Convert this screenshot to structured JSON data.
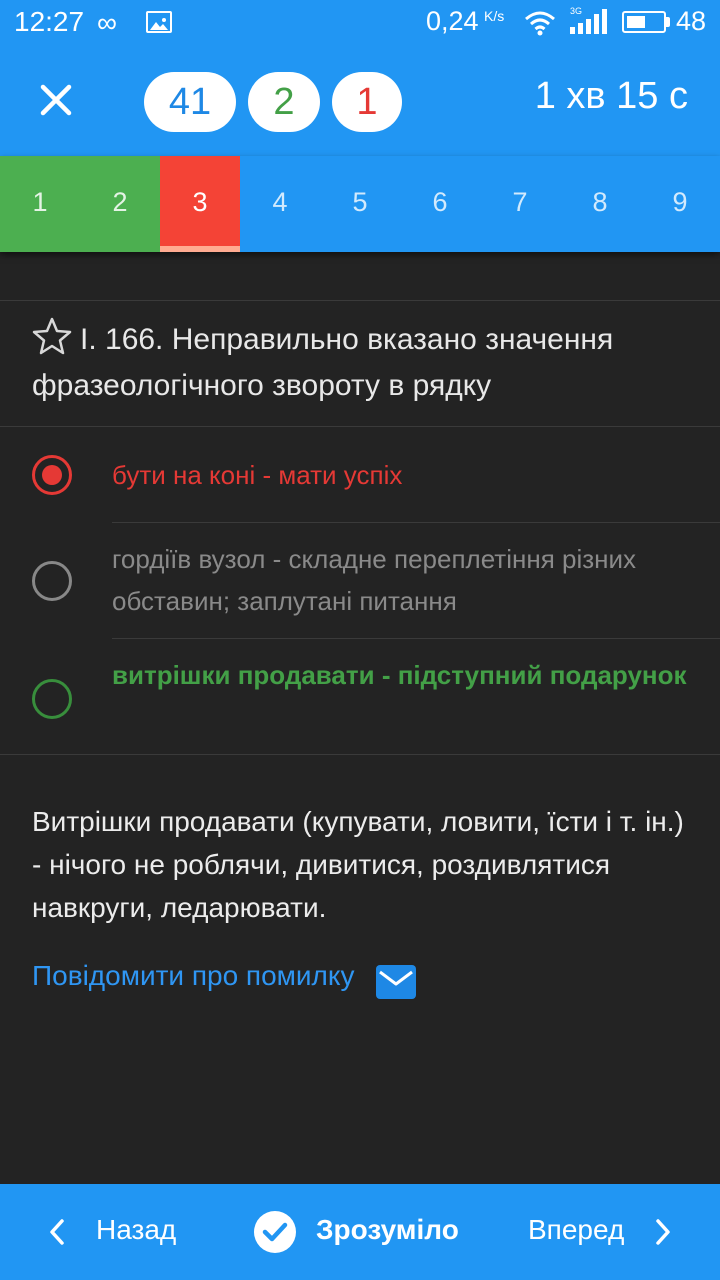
{
  "status_bar": {
    "time": "12:27",
    "speed": "0,24",
    "speed_unit": "K/s",
    "network_label": "3G",
    "battery": "48"
  },
  "header": {
    "total": "41",
    "correct": "2",
    "wrong": "1",
    "timer": "1 хв 15 с"
  },
  "tabs": [
    {
      "label": "1",
      "state": "correct"
    },
    {
      "label": "2",
      "state": "correct"
    },
    {
      "label": "3",
      "state": "wrong"
    },
    {
      "label": "4",
      "state": "pending"
    },
    {
      "label": "5",
      "state": "pending"
    },
    {
      "label": "6",
      "state": "pending"
    },
    {
      "label": "7",
      "state": "pending"
    },
    {
      "label": "8",
      "state": "pending"
    },
    {
      "label": "9",
      "state": "pending"
    }
  ],
  "question": {
    "text": "І. 166. Неправильно вказано значення фразеологічного звороту в рядку"
  },
  "options": [
    {
      "text": "бути на коні - мати успіх",
      "state": "selected-wrong",
      "color": "#e53935"
    },
    {
      "text": "гордіїв вузол - складне переплетіння різних обставин; заплутані питання",
      "state": "neutral",
      "color": "#8a8a8a"
    },
    {
      "text": "витрішки продавати - підступний подарунок",
      "state": "correct",
      "color": "#43a047"
    }
  ],
  "explanation": "Витрішки продавати (купувати, ловити, їсти і т. ін.) - нічого не роблячи, дивитися, роздивлятися навкруги, ледарювати.",
  "report_link": "Повідомити про помилку",
  "bottom_bar": {
    "back": "Назад",
    "ok": "Зрозуміло",
    "next": "Вперед"
  },
  "colors": {
    "primary": "#2196f3",
    "correct": "#4caf50",
    "wrong": "#f44336",
    "background": "#232323"
  }
}
